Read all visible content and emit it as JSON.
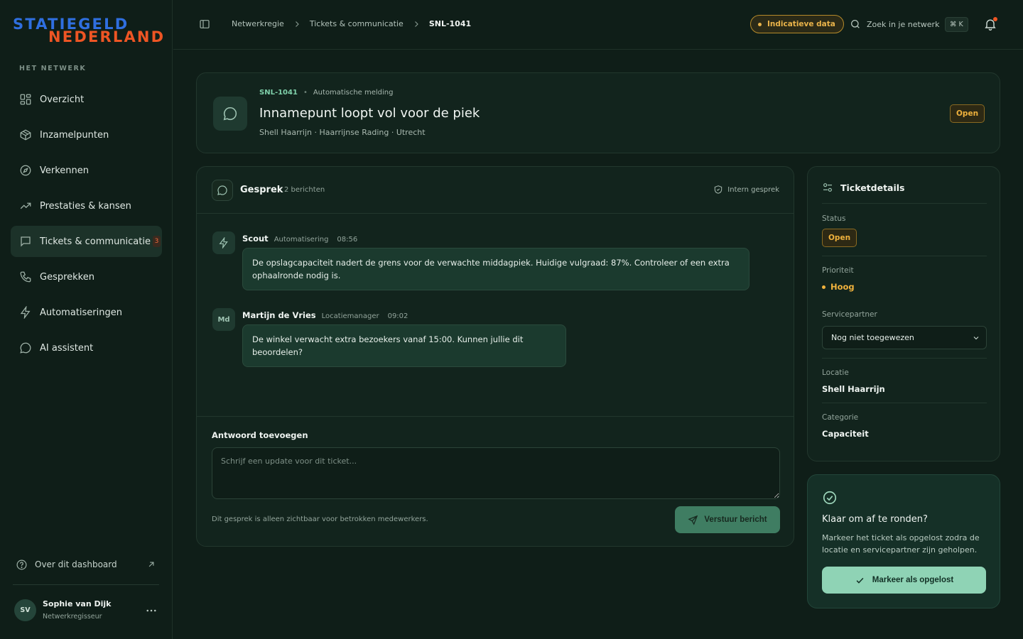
{
  "brand": {
    "line1": "STATIEGELD",
    "line2": "NEDERLAND"
  },
  "sidebar": {
    "heading": "HET NETWERK",
    "items": [
      {
        "label": "Overzicht",
        "icon": "grid-icon"
      },
      {
        "label": "Inzamelpunten",
        "icon": "box-icon"
      },
      {
        "label": "Verkennen",
        "icon": "compass-icon"
      },
      {
        "label": "Prestaties & kansen",
        "icon": "trend-icon"
      },
      {
        "label": "Tickets & communicatie",
        "icon": "message-icon",
        "badge": "3",
        "active": true
      },
      {
        "label": "Gesprekken",
        "icon": "phone-icon"
      },
      {
        "label": "Automatiseringen",
        "icon": "bolt-icon"
      },
      {
        "label": "AI assistent",
        "icon": "chat-bubble-icon"
      }
    ],
    "about": "Over dit dashboard",
    "user": {
      "initials": "SV",
      "name": "Sophie van Dijk",
      "role": "Netwerkregisseur"
    }
  },
  "topbar": {
    "breadcrumbs": [
      "Netwerkregie",
      "Tickets & communicatie",
      "SNL-1041"
    ],
    "data_badge": "Indicatieve data",
    "search_label": "Zoek in je netwerk",
    "shortcut": "⌘ K"
  },
  "ticket": {
    "id": "SNL-1041",
    "source": "Automatische melding",
    "title": "Innamepunt loopt vol voor de piek",
    "subtitle": "Shell Haarrijn · Haarrijnse Rading · Utrecht",
    "status": "Open"
  },
  "conversation": {
    "title": "Gesprek",
    "count": "2 berichten",
    "visibility": "Intern gesprek",
    "messages": [
      {
        "avatar": "",
        "name": "Scout",
        "role": "Automatisering",
        "time": "08:56",
        "text": "De opslagcapaciteit nadert de grens voor de verwachte middagpiek. Huidige vulgraad: 87%. Controleer of een extra ophaalronde nodig is."
      },
      {
        "avatar": "Md",
        "name": "Martijn de Vries",
        "role": "Locatiemanager",
        "time": "09:02",
        "text": "De winkel verwacht extra bezoekers vanaf 15:00. Kunnen jullie dit beoordelen?"
      }
    ],
    "reply_label": "Antwoord toevoegen",
    "reply_placeholder": "Schrijf een update voor dit ticket...",
    "reply_note": "Dit gesprek is alleen zichtbaar voor betrokken medewerkers.",
    "send_label": "Verstuur bericht"
  },
  "details": {
    "title": "Ticketdetails",
    "status_label": "Status",
    "status_value": "Open",
    "priority_label": "Prioriteit",
    "priority_value": "Hoog",
    "partner_label": "Servicepartner",
    "partner_value": "Nog niet toegewezen",
    "location_label": "Locatie",
    "location_value": "Shell Haarrijn",
    "category_label": "Categorie",
    "category_value": "Capaciteit"
  },
  "resolve": {
    "title": "Klaar om af te ronden?",
    "text": "Markeer het ticket als opgelost zodra de locatie en servicepartner zijn geholpen.",
    "button": "Markeer als opgelost"
  },
  "colors": {
    "background": "#0f1e18",
    "accent_green": "#8fd3b5",
    "accent_amber": "#f0b23d",
    "brand_blue": "#2f6fe0",
    "brand_orange": "#ee5524"
  }
}
